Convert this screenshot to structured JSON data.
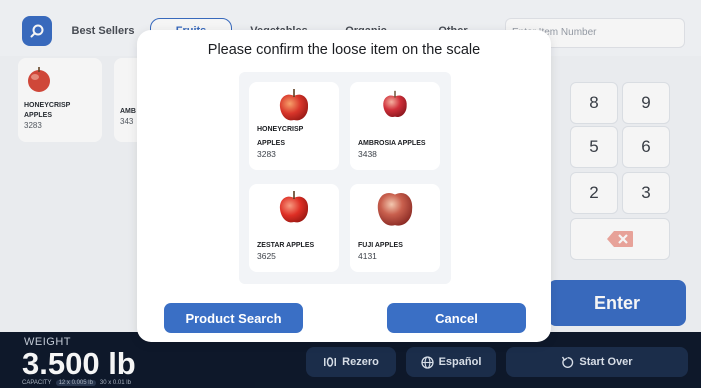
{
  "topbar": {
    "tabs": [
      {
        "label": "Best Sellers",
        "active": false
      },
      {
        "label": "Fruits",
        "active": true
      },
      {
        "label": "Vegetables",
        "active": false
      },
      {
        "label": "Organic",
        "active": false
      },
      {
        "label": "Other",
        "active": false
      }
    ],
    "item_number_placeholder": "Enter Item Number"
  },
  "background_products": [
    {
      "name_line1": "HONEYCRISP",
      "name_line2": "APPLES",
      "number": "3283"
    },
    {
      "name_line1": "",
      "name_line2": "AMB",
      "number": "343"
    }
  ],
  "numpad": {
    "keys": [
      "8",
      "9",
      "5",
      "6",
      "2",
      "3"
    ],
    "enter_label": "Enter"
  },
  "scale": {
    "label": "WEIGHT",
    "value": "3.500 lb",
    "capacity_label": "CAPACITY",
    "capacity_pill": "12 x 0.005 lb",
    "capacity_extra": "30 x 0.01 lb"
  },
  "bottom_buttons": {
    "rezero": "Rezero",
    "language": "Español",
    "start_over": "Start Over"
  },
  "modal": {
    "title": "Please confirm the loose item on the scale",
    "items": [
      {
        "name_line1": "HONEYCRISP",
        "name_line2": "APPLES",
        "number": "3283"
      },
      {
        "name_line1": "",
        "name_line2": "AMBROSIA APPLES",
        "number": "3438"
      },
      {
        "name_line1": "",
        "name_line2": "ZESTAR APPLES",
        "number": "3625"
      },
      {
        "name_line1": "",
        "name_line2": "FUJI APPLES",
        "number": "4131"
      }
    ],
    "product_search_label": "Product Search",
    "cancel_label": "Cancel"
  },
  "colors": {
    "accent": "#3a6fc5",
    "bottom_bar": "#0f1a2c"
  }
}
